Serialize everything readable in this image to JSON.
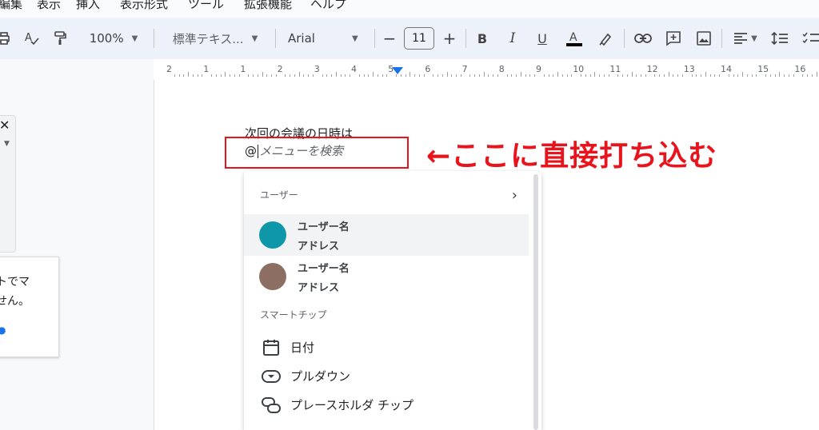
{
  "menu": {
    "items": [
      "編集",
      "表示",
      "挿入",
      "表示形式",
      "ツール",
      "拡張機能",
      "ヘルプ"
    ]
  },
  "toolbar": {
    "zoom": "100%",
    "style": "標準テキス...",
    "font": "Arial",
    "font_size": "11",
    "decrease": "−",
    "increase": "+"
  },
  "ruler": {
    "labels": [
      "2",
      "1",
      "1",
      "2",
      "3",
      "4",
      "5",
      "6",
      "7",
      "8",
      "9",
      "10",
      "11",
      "12",
      "13",
      "14",
      "15",
      "16"
    ]
  },
  "side": {
    "panel_text_line1": "トでマ",
    "panel_text_line2": "せん。"
  },
  "document": {
    "line1": "次回の会議の日時は",
    "at": "@",
    "search_placeholder": "メニューを検索"
  },
  "annotation": {
    "text": "←ここに直接打ち込む",
    "color": "#e8131b"
  },
  "dropdown": {
    "users_label": "ユーザー",
    "users": [
      {
        "name": "ユーザー名",
        "address": "アドレス",
        "color": "#0d97a8"
      },
      {
        "name": "ユーザー名",
        "address": "アドレス",
        "color": "#8d6e63"
      }
    ],
    "smart_chips_label": "スマートチップ",
    "chips": [
      {
        "label": "日付",
        "icon": "calendar-icon"
      },
      {
        "label": "プルダウン",
        "icon": "dropdown-chip-icon"
      },
      {
        "label": "プレースホルダ チップ",
        "icon": "placeholder-chip-icon"
      }
    ]
  }
}
